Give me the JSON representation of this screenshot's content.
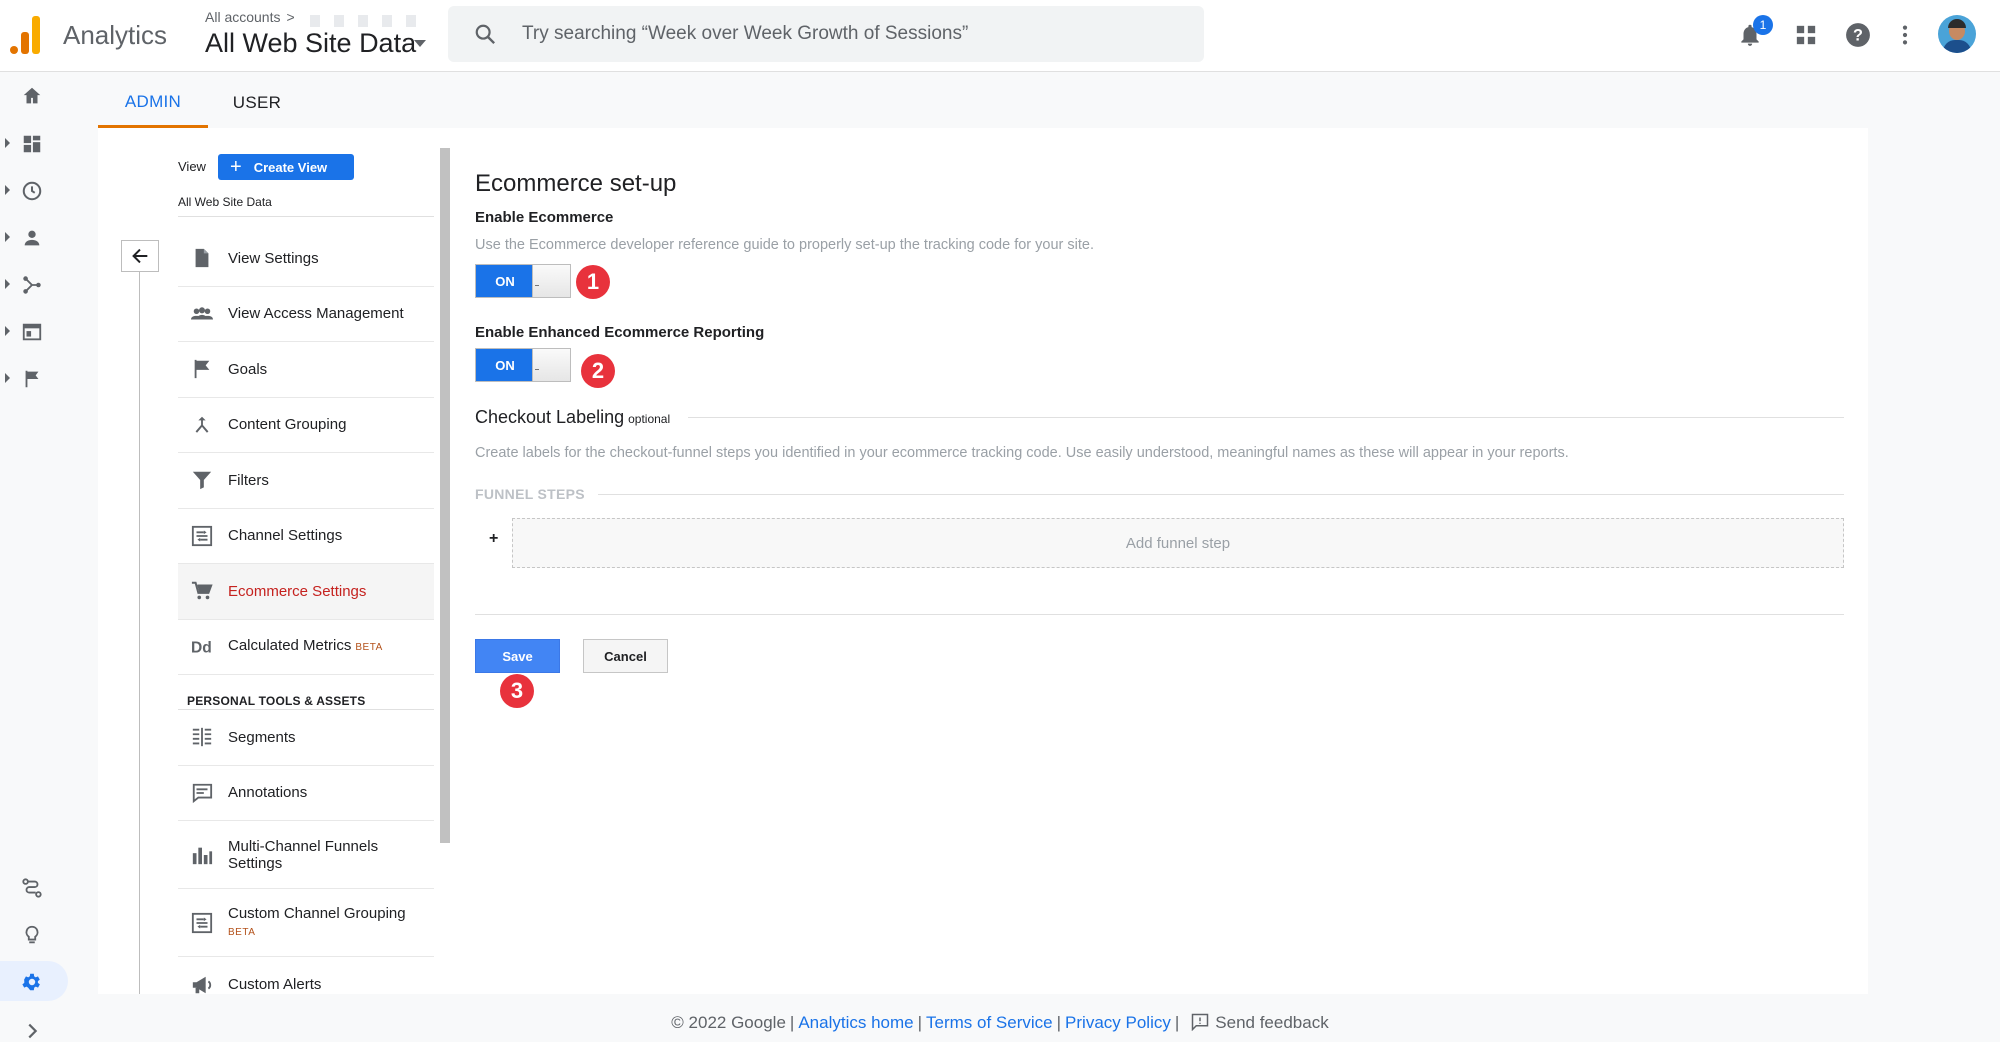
{
  "app": {
    "name": "Analytics",
    "account_crumb": "All accounts",
    "crumb_chevron": ">",
    "view_name": "All Web Site Data"
  },
  "search": {
    "placeholder": "Try searching “Week over Week Growth of Sessions”"
  },
  "topbar": {
    "notification_count": "1"
  },
  "tabs": [
    {
      "label": "ADMIN",
      "active": true
    },
    {
      "label": "USER",
      "active": false
    }
  ],
  "view_panel": {
    "view_label": "View",
    "create_view_label": "Create View",
    "view_name": "All Web Site Data",
    "items": [
      {
        "label": "View Settings",
        "icon": "document-icon"
      },
      {
        "label": "View Access Management",
        "icon": "people-icon"
      },
      {
        "label": "Goals",
        "icon": "flag-icon"
      },
      {
        "label": "Content Grouping",
        "icon": "merge-icon"
      },
      {
        "label": "Filters",
        "icon": "filter-icon"
      },
      {
        "label": "Channel Settings",
        "icon": "channel-icon"
      },
      {
        "label": "Ecommerce Settings",
        "icon": "cart-icon",
        "active": true
      },
      {
        "label": "Calculated Metrics",
        "badge": "BETA",
        "icon": "dd-icon"
      }
    ],
    "personal_heading": "PERSONAL TOOLS & ASSETS",
    "personal_items": [
      {
        "label": "Segments",
        "icon": "segments-icon"
      },
      {
        "label": "Annotations",
        "icon": "annotation-icon"
      },
      {
        "label": "Multi-Channel Funnels Settings",
        "icon": "bar-chart-icon"
      },
      {
        "label": "Custom Channel Grouping",
        "badge": "BETA",
        "icon": "channel-icon"
      },
      {
        "label": "Custom Alerts",
        "icon": "megaphone-icon"
      }
    ]
  },
  "ecommerce": {
    "title": "Ecommerce set-up",
    "enable_label": "Enable Ecommerce",
    "enable_help": "Use the Ecommerce developer reference guide to properly set-up the tracking code for your site.",
    "toggle_on_label": "ON",
    "enhanced_label": "Enable Enhanced Ecommerce Reporting",
    "checkout_title": "Checkout Labeling",
    "checkout_optional": "optional",
    "checkout_help": "Create labels for the checkout-funnel steps you identified in your ecommerce tracking code. Use easily understood, meaningful names as these will appear in your reports.",
    "funnel_steps_label": "FUNNEL STEPS",
    "funnel_plus": "+",
    "add_step_label": "Add funnel step",
    "save_label": "Save",
    "cancel_label": "Cancel"
  },
  "markers": [
    "1",
    "2",
    "3"
  ],
  "colors": {
    "accent": "#1a73e8",
    "tab_underline": "#e37400",
    "active_nav": "#c5221f",
    "marker": "#e8323c"
  },
  "footer": {
    "copyright": "© 2022 Google",
    "analytics_home": "Analytics home",
    "terms": "Terms of Service",
    "privacy": "Privacy Policy",
    "separator": "|",
    "feedback": "Send feedback"
  }
}
